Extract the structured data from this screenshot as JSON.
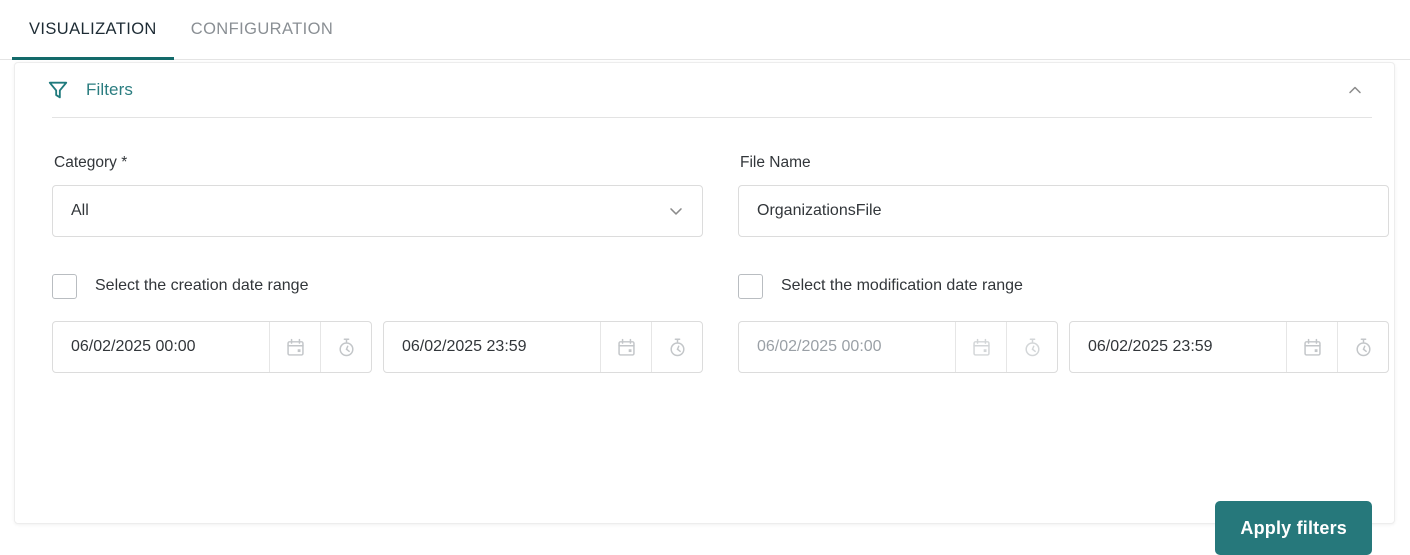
{
  "tabs": [
    {
      "label": "VISUALIZATION",
      "active": true
    },
    {
      "label": "CONFIGURATION",
      "active": false
    }
  ],
  "filters_card": {
    "title": "Filters",
    "filter_icon": "funnel-icon",
    "collapse_icon": "chevron-up-icon",
    "accent_color": "#2b7d80",
    "category": {
      "label": "Category *",
      "value": "All",
      "chevron_icon": "chevron-down-icon"
    },
    "file_name": {
      "label": "File Name",
      "value": "OrganizationsFile",
      "placeholder": ""
    },
    "creation_range": {
      "checkbox_label": "Select the creation date range",
      "checked": false,
      "from": "06/02/2025 00:00",
      "to": "06/02/2025 23:59",
      "calendar_icon": "calendar-icon",
      "time_icon": "stopwatch-icon"
    },
    "modification_range": {
      "checkbox_label": "Select the modification date range",
      "checked": false,
      "from": "06/02/2025 00:00",
      "to": "06/02/2025 23:59",
      "calendar_icon": "calendar-icon",
      "time_icon": "stopwatch-icon"
    },
    "apply_button": {
      "label": "Apply filters",
      "color": "#26787b"
    }
  }
}
